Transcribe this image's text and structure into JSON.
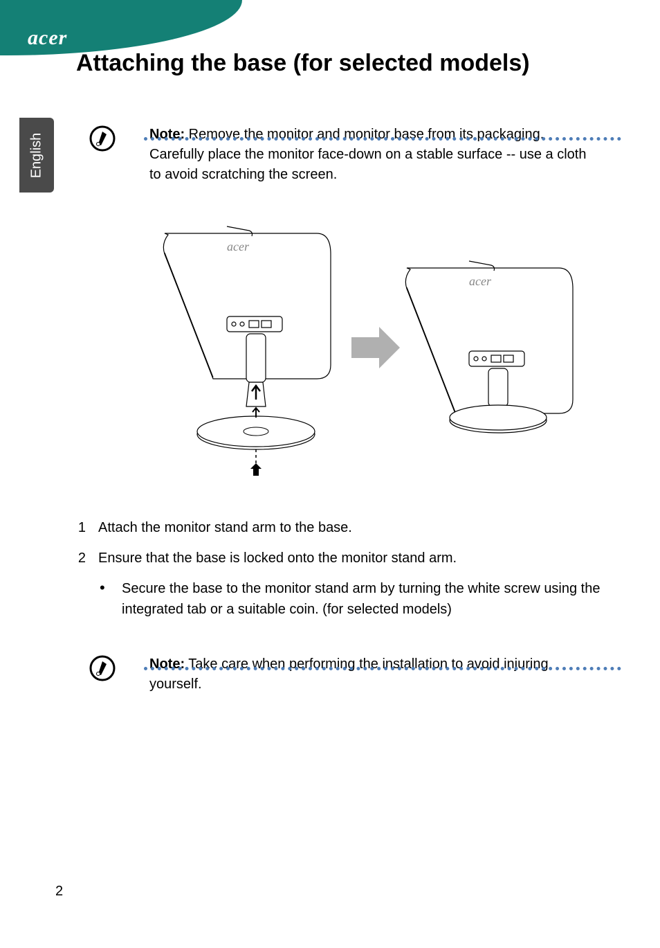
{
  "brand": "acer",
  "language_tab": "English",
  "page_title": "Attaching the base (for selected models)",
  "note1": {
    "label": "Note:",
    "text": " Remove the monitor and monitor base from its packaging. Carefully place the monitor face-down on a stable surface -- use a cloth to avoid scratching the screen."
  },
  "steps": [
    {
      "num": "1",
      "text": "Attach the monitor stand arm to the base."
    },
    {
      "num": "2",
      "text": "Ensure that the base is locked onto the monitor stand arm."
    }
  ],
  "bullet": {
    "dot": "•",
    "text": "Secure the base to the monitor stand arm by turning the white screw using the integrated tab or a suitable coin. (for selected models)"
  },
  "note2": {
    "label": "Note:",
    "text": " Take care when performing the installation to avoid injuring yourself."
  },
  "page_number": "2"
}
